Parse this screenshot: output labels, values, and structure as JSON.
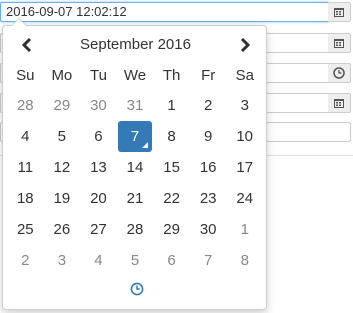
{
  "form": {
    "datetime_value": "2016-09-07 12:02:12",
    "field_icons": [
      "calendar-icon",
      "calendar-icon",
      "clock-icon",
      "calendar-icon"
    ]
  },
  "picker": {
    "month_title": "September 2016",
    "prev_icon": "chevron-left-icon",
    "next_icon": "chevron-right-icon",
    "weekdays": [
      "Su",
      "Mo",
      "Tu",
      "We",
      "Th",
      "Fr",
      "Sa"
    ],
    "weeks": [
      [
        {
          "d": "28",
          "o": true
        },
        {
          "d": "29",
          "o": true
        },
        {
          "d": "30",
          "o": true
        },
        {
          "d": "31",
          "o": true
        },
        {
          "d": "1"
        },
        {
          "d": "2"
        },
        {
          "d": "3"
        }
      ],
      [
        {
          "d": "4"
        },
        {
          "d": "5"
        },
        {
          "d": "6"
        },
        {
          "d": "7",
          "sel": true
        },
        {
          "d": "8"
        },
        {
          "d": "9"
        },
        {
          "d": "10"
        }
      ],
      [
        {
          "d": "11"
        },
        {
          "d": "12"
        },
        {
          "d": "13"
        },
        {
          "d": "14"
        },
        {
          "d": "15"
        },
        {
          "d": "16"
        },
        {
          "d": "17"
        }
      ],
      [
        {
          "d": "18"
        },
        {
          "d": "19"
        },
        {
          "d": "20"
        },
        {
          "d": "21"
        },
        {
          "d": "22"
        },
        {
          "d": "23"
        },
        {
          "d": "24"
        }
      ],
      [
        {
          "d": "25"
        },
        {
          "d": "26"
        },
        {
          "d": "27"
        },
        {
          "d": "28"
        },
        {
          "d": "29"
        },
        {
          "d": "30"
        },
        {
          "d": "1",
          "o": true
        }
      ],
      [
        {
          "d": "2",
          "o": true
        },
        {
          "d": "3",
          "o": true
        },
        {
          "d": "4",
          "o": true
        },
        {
          "d": "5",
          "o": true
        },
        {
          "d": "6",
          "o": true
        },
        {
          "d": "7",
          "o": true
        },
        {
          "d": "8",
          "o": true
        }
      ]
    ],
    "time_toggle_icon": "clock-icon",
    "selected_color": "#337ab7",
    "accent_color": "#337ab7"
  }
}
